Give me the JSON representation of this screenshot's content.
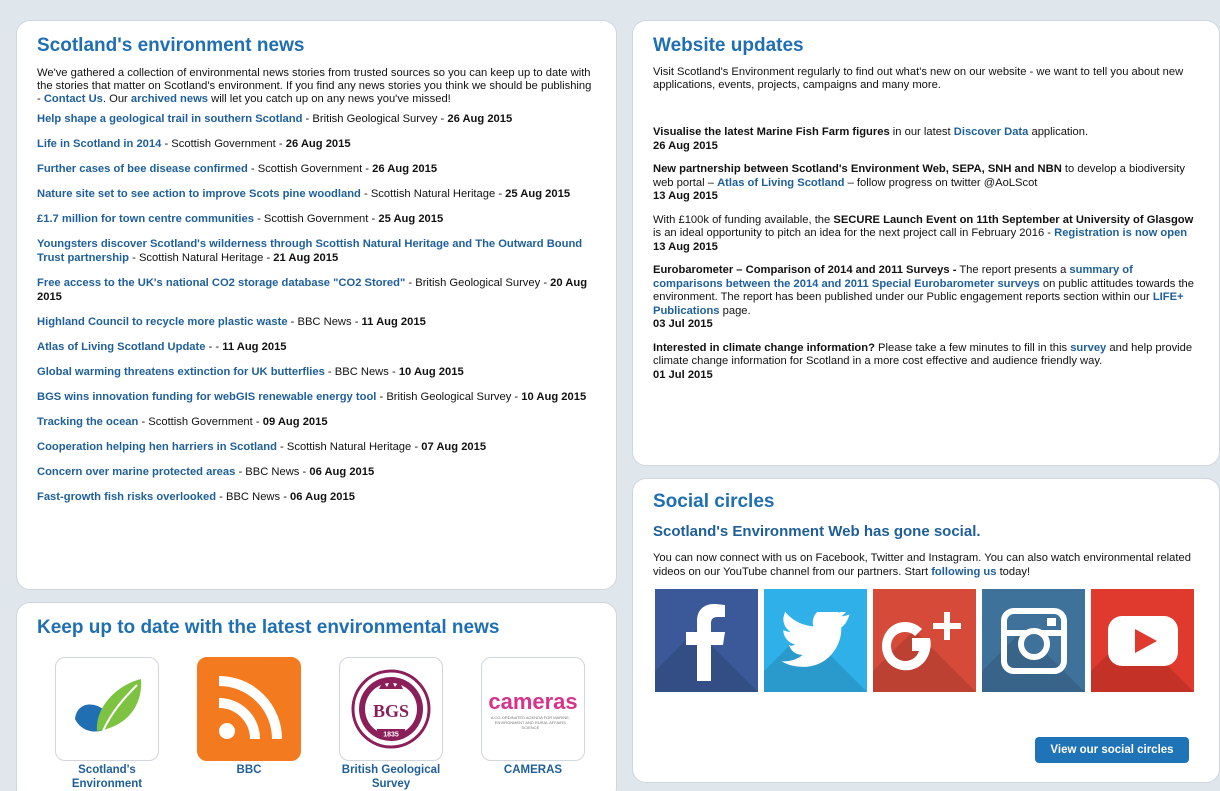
{
  "news": {
    "title": "Scotland's environment news",
    "intro_1": "We've gathered a collection of environmental news stories from trusted sources so you can keep up to date with the stories that matter on Scotland's environment. If you find any news stories you think we should be publishing - ",
    "intro_contact": "Contact Us",
    "intro_2": ". Our ",
    "intro_archived": "archived news",
    "intro_3": " will let you catch up on any news you've missed!",
    "items": [
      {
        "title": "Help shape a geological trail in southern Scotland",
        "source": "British Geological Survey",
        "date": "26 Aug 2015"
      },
      {
        "title": "Life in Scotland in 2014",
        "source": "Scottish Government",
        "date": "26 Aug 2015"
      },
      {
        "title": "Further cases of bee disease confirmed",
        "source": "Scottish Government",
        "date": "26 Aug 2015"
      },
      {
        "title": "Nature site set to see action to improve Scots pine woodland",
        "source": "Scottish Natural Heritage",
        "date": "25 Aug 2015"
      },
      {
        "title": "£1.7 million for town centre communities",
        "source": "Scottish Government",
        "date": "25 Aug 2015"
      },
      {
        "title": "Youngsters discover Scotland's wilderness through Scottish Natural Heritage and The Outward Bound Trust partnership",
        "source": "Scottish Natural Heritage",
        "date": "21 Aug 2015"
      },
      {
        "title": "Free access to the UK's national CO2 storage database \"CO2 Stored\"",
        "source": "British Geological Survey",
        "date": "20 Aug 2015"
      },
      {
        "title": "Highland Council to recycle more plastic waste",
        "source": "BBC News",
        "date": "11 Aug 2015"
      },
      {
        "title": "Atlas of Living Scotland Update",
        "source": "",
        "date": "11 Aug 2015"
      },
      {
        "title": "Global warming threatens extinction for UK butterflies",
        "source": "BBC News",
        "date": "10 Aug 2015"
      },
      {
        "title": "BGS wins innovation funding for webGIS renewable energy tool",
        "source": "British Geological Survey",
        "date": "10 Aug 2015"
      },
      {
        "title": "Tracking the ocean",
        "source": "Scottish Government",
        "date": "09 Aug 2015"
      },
      {
        "title": "Cooperation helping hen harriers in Scotland",
        "source": "Scottish Natural Heritage",
        "date": "07 Aug 2015"
      },
      {
        "title": "Concern over marine protected areas",
        "source": "BBC News",
        "date": "06 Aug 2015"
      },
      {
        "title": "Fast-growth fish risks overlooked",
        "source": "BBC News",
        "date": "06 Aug 2015"
      }
    ]
  },
  "updates": {
    "title": "Website updates",
    "intro": "Visit Scotland's Environment regularly to find out what's new on our website - we want to tell you about new applications, events, projects, campaigns and many more.",
    "u1": {
      "bold": "Visualise the latest Marine Fish Farm figures",
      "text": " in our latest ",
      "link": "Discover Data",
      "text2": " application.",
      "date": "26 Aug 2015"
    },
    "u2": {
      "bold": "New partnership between Scotland's Environment Web, SEPA, SNH and NBN",
      "text": " to develop a biodiversity web portal – ",
      "link": "Atlas of Living Scotland",
      "text2": " – follow progress on twitter @AoLScot",
      "date": "13 Aug 2015"
    },
    "u3": {
      "text": "With £100k of funding available, the ",
      "bold": "SECURE Launch Event on 11th September at University of Glasgow",
      "text2": " is an ideal opportunity to pitch an idea for the next project call in February 2016 - ",
      "link": "Registration is now open",
      "date": "13 Aug 2015"
    },
    "u4": {
      "bold": "Eurobarometer – Comparison of 2014 and 2011 Surveys -",
      "text": " The report presents a ",
      "link": "summary of comparisons between the 2014 and 2011 Special Eurobarometer surveys",
      "text2": " on public attitudes towards the environment. The report has been published under our Public engagement reports section within our ",
      "link2": "LIFE+ Publications",
      "text3": " page.",
      "date": "03 Jul 2015"
    },
    "u5": {
      "bold": "Interested in climate change information?",
      "text": " Please take a few minutes to fill in this ",
      "link": "survey",
      "text2": " and help provide climate change information for Scotland in a more cost effective and audience friendly way.",
      "date": "01 Jul 2015"
    }
  },
  "social": {
    "title": "Social circles",
    "subtitle": "Scotland's Environment Web has gone social.",
    "text": "You can now connect with us on Facebook, Twitter and Instagram. You can also watch environmental related videos on our YouTube channel from our partners. Start ",
    "link": "following us",
    "text2": " today!",
    "button": "View our social circles",
    "icons": [
      {
        "name": "facebook-icon",
        "color": "#3b5998"
      },
      {
        "name": "twitter-icon",
        "color": "#2fb0e8"
      },
      {
        "name": "google-plus-icon",
        "color": "#d64a3a"
      },
      {
        "name": "instagram-icon",
        "color": "#3f729b"
      },
      {
        "name": "youtube-icon",
        "color": "#e0392d"
      }
    ]
  },
  "keep": {
    "title": "Keep up to date with the latest environmental news",
    "feeds": [
      {
        "label": "Scotland's Environment",
        "icon": "leaf-logo"
      },
      {
        "label": "BBC",
        "icon": "rss-icon"
      },
      {
        "label": "British Geological Survey",
        "icon": "bgs-logo",
        "logo_text": "BGS",
        "logo_year": "1835"
      },
      {
        "label": "CAMERAS",
        "icon": "cameras-logo",
        "logo_text": "cameras",
        "logo_sub": "A CO-ORDINATED AGENDA FOR MARINE, ENVIRONMENT AND RURAL AFFAIRS SCIENCE"
      }
    ]
  }
}
